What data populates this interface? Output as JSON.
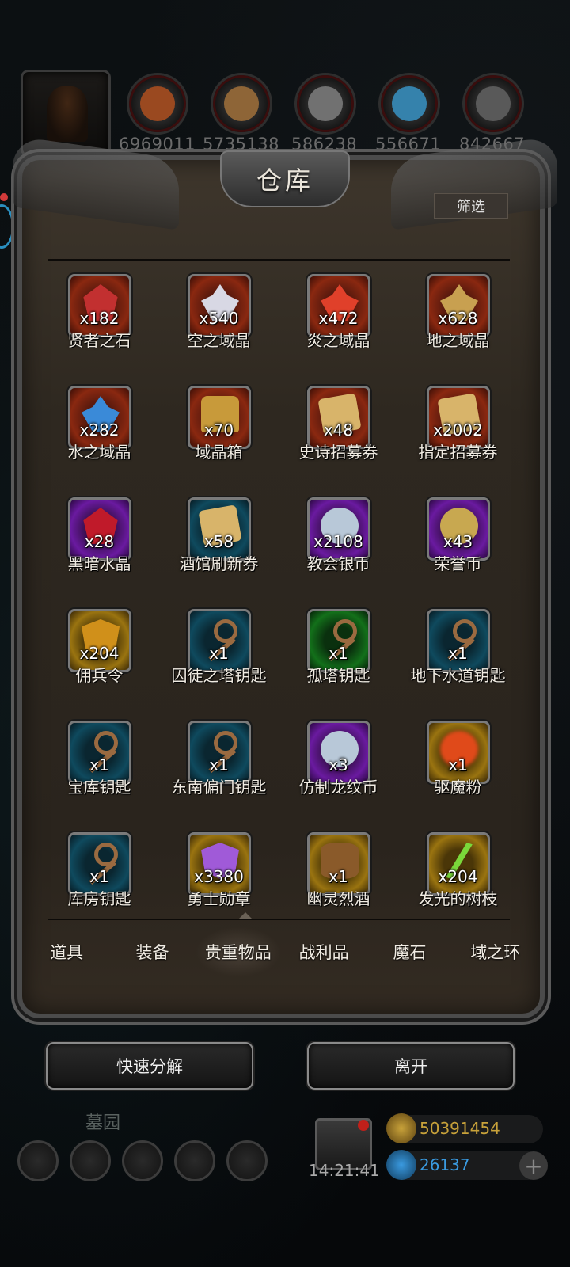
{
  "resources": [
    {
      "icon": "meat-icon",
      "value": "6969011",
      "color": "#c0541e"
    },
    {
      "icon": "wood-icon",
      "value": "5735138",
      "color": "#b07a3c"
    },
    {
      "icon": "stone-icon",
      "value": "586238",
      "color": "#8a8a8a"
    },
    {
      "icon": "crystal-icon",
      "value": "556671",
      "color": "#3aa0d8"
    },
    {
      "icon": "iron-icon",
      "value": "842667",
      "color": "#6a6a6a"
    }
  ],
  "panel": {
    "title": "仓库",
    "filter_label": "筛选"
  },
  "items": [
    {
      "name": "贤者之石",
      "qty": "x182",
      "frame": "red",
      "art": "gem",
      "color": "#c23030",
      "icon": "red-stone-icon"
    },
    {
      "name": "空之域晶",
      "qty": "x540",
      "frame": "red",
      "art": "crystal",
      "color": "#d8d8e4",
      "icon": "sky-crystal-icon"
    },
    {
      "name": "炎之域晶",
      "qty": "x472",
      "frame": "red",
      "art": "crystal",
      "color": "#e0402a",
      "icon": "flame-crystal-icon"
    },
    {
      "name": "地之域晶",
      "qty": "x628",
      "frame": "red",
      "art": "crystal",
      "color": "#c8a050",
      "icon": "earth-crystal-icon"
    },
    {
      "name": "水之域晶",
      "qty": "x282",
      "frame": "red",
      "art": "crystal",
      "color": "#3a8ad8",
      "icon": "water-crystal-icon"
    },
    {
      "name": "域晶箱",
      "qty": "x70",
      "frame": "red",
      "art": "chest",
      "color": "#c89a3a",
      "icon": "chest-icon"
    },
    {
      "name": "史诗招募券",
      "qty": "x48",
      "frame": "red",
      "art": "scroll",
      "color": "#d8b46a",
      "icon": "scroll-icon"
    },
    {
      "name": "指定招募券",
      "qty": "x2002",
      "frame": "red",
      "art": "scroll",
      "color": "#d8b46a",
      "icon": "scroll-icon"
    },
    {
      "name": "黑暗水晶",
      "qty": "x28",
      "frame": "purple",
      "art": "gem",
      "color": "#c01a2a",
      "icon": "dark-crystal-icon"
    },
    {
      "name": "酒馆刷新券",
      "qty": "x58",
      "frame": "blue",
      "art": "scroll",
      "color": "#d8b46a",
      "icon": "scroll-icon"
    },
    {
      "name": "教会银币",
      "qty": "x2108",
      "frame": "purple",
      "art": "coin",
      "color": "#b8c8d8",
      "icon": "silver-coin-icon"
    },
    {
      "name": "荣誉币",
      "qty": "x43",
      "frame": "purple",
      "art": "coin",
      "color": "#c8a850",
      "icon": "gold-coin-icon"
    },
    {
      "name": "佣兵令",
      "qty": "x204",
      "frame": "gold",
      "art": "badge",
      "color": "#d0901a",
      "icon": "mercenary-badge-icon"
    },
    {
      "name": "囚徒之塔钥匙",
      "qty": "x1",
      "frame": "blue",
      "art": "key",
      "color": "#9a6a40",
      "icon": "key-icon"
    },
    {
      "name": "孤塔钥匙",
      "qty": "x1",
      "frame": "green",
      "art": "key",
      "color": "#9a6a40",
      "icon": "key-icon"
    },
    {
      "name": "地下水道钥匙",
      "qty": "x1",
      "frame": "blue",
      "art": "key",
      "color": "#9a6a40",
      "icon": "key-icon"
    },
    {
      "name": "宝库钥匙",
      "qty": "x1",
      "frame": "blue",
      "art": "key",
      "color": "#9a6a40",
      "icon": "key-icon"
    },
    {
      "name": "东南偏门钥匙",
      "qty": "x1",
      "frame": "blue",
      "art": "key",
      "color": "#9a6a40",
      "icon": "key-icon"
    },
    {
      "name": "仿制龙纹币",
      "qty": "x3",
      "frame": "purple",
      "art": "coin",
      "color": "#b8c8d8",
      "icon": "dragon-coin-icon"
    },
    {
      "name": "驱魔粉",
      "qty": "x1",
      "frame": "gold",
      "art": "powder",
      "color": "#e04a1a",
      "icon": "powder-icon"
    },
    {
      "name": "库房钥匙",
      "qty": "x1",
      "frame": "blue",
      "art": "key",
      "color": "#9a6a40",
      "icon": "key-icon"
    },
    {
      "name": "勇士勋章",
      "qty": "x3380",
      "frame": "gold",
      "art": "badge",
      "color": "#a05ad8",
      "icon": "medal-icon"
    },
    {
      "name": "幽灵烈酒",
      "qty": "x1",
      "frame": "gold",
      "art": "barrel",
      "color": "#8a5a2a",
      "icon": "barrel-icon"
    },
    {
      "name": "发光的树枝",
      "qty": "x204",
      "frame": "gold",
      "art": "branch",
      "color": "#7ad83a",
      "icon": "branch-icon"
    }
  ],
  "tabs": [
    "道具",
    "装备",
    "贵重物品",
    "战利品",
    "魔石",
    "域之环"
  ],
  "active_tab": "贵重物品",
  "actions": {
    "decompose_label": "快速分解",
    "leave_label": "离开"
  },
  "hud": {
    "location": "墓园",
    "time": "14:21:41",
    "gold": "50391454",
    "gold_color": "#c8a23a",
    "gems": "26137",
    "gems_color": "#3a9ae0",
    "plus": "+"
  }
}
